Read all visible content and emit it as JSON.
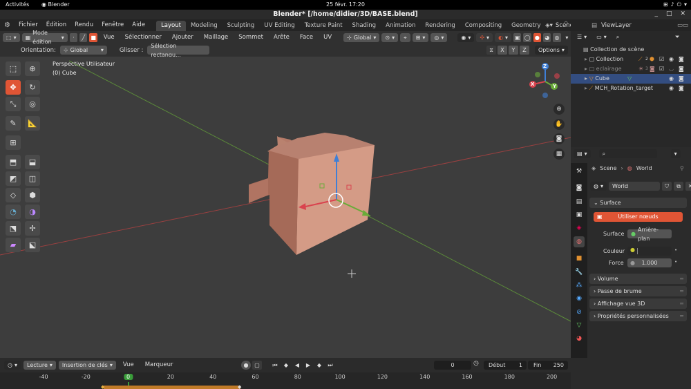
{
  "gnome": {
    "activities": "Activités",
    "app": "Blender",
    "clock": "25 févr.  17:20"
  },
  "window": {
    "title": "Blender* [/home/didier/3D/BASE.blend]"
  },
  "menu": [
    "Fichier",
    "Édition",
    "Rendu",
    "Fenêtre",
    "Aide"
  ],
  "workspaces": [
    "Layout",
    "Modeling",
    "Sculpting",
    "UV Editing",
    "Texture Paint",
    "Shading",
    "Animation",
    "Rendering",
    "Compositing",
    "Geometry No"
  ],
  "scene_name": "Scene",
  "view_layer": "ViewLayer",
  "viewport_header": {
    "mode": "Mode édition",
    "menus": [
      "Vue",
      "Sélectionner",
      "Ajouter",
      "Maillage",
      "Sommet",
      "Arête",
      "Face",
      "UV"
    ],
    "transform": "Global"
  },
  "tool_header": {
    "orientation_label": "Orientation:",
    "orientation_value": "Global",
    "drag_label": "Glisser :",
    "drag_value": "Sélection rectangu...",
    "axes": [
      "X",
      "Y",
      "Z"
    ],
    "options": "Options"
  },
  "viewport": {
    "view_name": "Perspective Utilisateur",
    "object_name": "(0) Cube",
    "gizmo": {
      "z": "Z",
      "y": "Y",
      "x": "X"
    }
  },
  "outliner": {
    "root": "Collection de scène",
    "items": [
      {
        "name": "Collection",
        "badge": "2"
      },
      {
        "name": "eclairage",
        "badge": "3"
      },
      {
        "name": "Cube"
      },
      {
        "name": "MCH_Rotation_target"
      }
    ]
  },
  "properties": {
    "breadcrumb_scene": "Scene",
    "breadcrumb_world": "World",
    "world_name": "World",
    "surface_panel": "Surface",
    "use_nodes": "Utiliser nœuds",
    "surface_label": "Surface",
    "surface_value": "Arrière-plan",
    "color_label": "Couleur",
    "strength_label": "Force",
    "strength_value": "1.000",
    "panels": [
      "Volume",
      "Passe de brume",
      "Affichage vue 3D",
      "Propriétés personnalisées"
    ]
  },
  "timeline": {
    "menus": [
      "Lecture",
      "Insertion de clés",
      "Vue",
      "Marqueur"
    ],
    "current_frame": "0",
    "start_label": "Début",
    "start_value": "1",
    "end_label": "Fin",
    "end_value": "250",
    "ruler": [
      "-40",
      "-20",
      "0",
      "20",
      "40",
      "60",
      "80",
      "100",
      "120",
      "140",
      "160",
      "180",
      "200"
    ]
  },
  "colors": {
    "accent": "#e05535",
    "selection": "#334d80",
    "cube_face": "#c98a76",
    "axis_x": "#d9434e",
    "axis_y": "#6aab3a",
    "axis_z": "#3f7fd6"
  }
}
